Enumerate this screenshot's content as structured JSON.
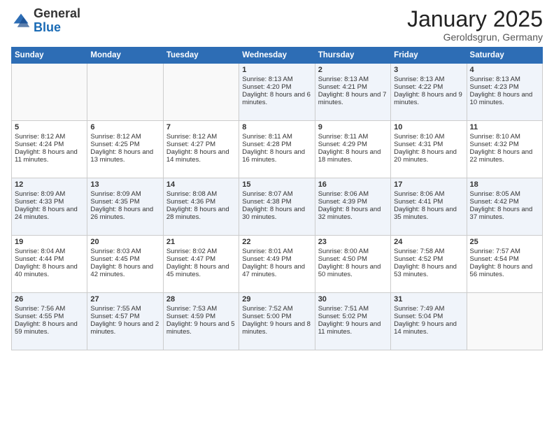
{
  "logo": {
    "general": "General",
    "blue": "Blue"
  },
  "title": "January 2025",
  "subtitle": "Geroldsgrun, Germany",
  "days_of_week": [
    "Sunday",
    "Monday",
    "Tuesday",
    "Wednesday",
    "Thursday",
    "Friday",
    "Saturday"
  ],
  "weeks": [
    [
      {
        "day": "",
        "content": ""
      },
      {
        "day": "",
        "content": ""
      },
      {
        "day": "",
        "content": ""
      },
      {
        "day": "1",
        "content": "Sunrise: 8:13 AM\nSunset: 4:20 PM\nDaylight: 8 hours and 6 minutes."
      },
      {
        "day": "2",
        "content": "Sunrise: 8:13 AM\nSunset: 4:21 PM\nDaylight: 8 hours and 7 minutes."
      },
      {
        "day": "3",
        "content": "Sunrise: 8:13 AM\nSunset: 4:22 PM\nDaylight: 8 hours and 9 minutes."
      },
      {
        "day": "4",
        "content": "Sunrise: 8:13 AM\nSunset: 4:23 PM\nDaylight: 8 hours and 10 minutes."
      }
    ],
    [
      {
        "day": "5",
        "content": "Sunrise: 8:12 AM\nSunset: 4:24 PM\nDaylight: 8 hours and 11 minutes."
      },
      {
        "day": "6",
        "content": "Sunrise: 8:12 AM\nSunset: 4:25 PM\nDaylight: 8 hours and 13 minutes."
      },
      {
        "day": "7",
        "content": "Sunrise: 8:12 AM\nSunset: 4:27 PM\nDaylight: 8 hours and 14 minutes."
      },
      {
        "day": "8",
        "content": "Sunrise: 8:11 AM\nSunset: 4:28 PM\nDaylight: 8 hours and 16 minutes."
      },
      {
        "day": "9",
        "content": "Sunrise: 8:11 AM\nSunset: 4:29 PM\nDaylight: 8 hours and 18 minutes."
      },
      {
        "day": "10",
        "content": "Sunrise: 8:10 AM\nSunset: 4:31 PM\nDaylight: 8 hours and 20 minutes."
      },
      {
        "day": "11",
        "content": "Sunrise: 8:10 AM\nSunset: 4:32 PM\nDaylight: 8 hours and 22 minutes."
      }
    ],
    [
      {
        "day": "12",
        "content": "Sunrise: 8:09 AM\nSunset: 4:33 PM\nDaylight: 8 hours and 24 minutes."
      },
      {
        "day": "13",
        "content": "Sunrise: 8:09 AM\nSunset: 4:35 PM\nDaylight: 8 hours and 26 minutes."
      },
      {
        "day": "14",
        "content": "Sunrise: 8:08 AM\nSunset: 4:36 PM\nDaylight: 8 hours and 28 minutes."
      },
      {
        "day": "15",
        "content": "Sunrise: 8:07 AM\nSunset: 4:38 PM\nDaylight: 8 hours and 30 minutes."
      },
      {
        "day": "16",
        "content": "Sunrise: 8:06 AM\nSunset: 4:39 PM\nDaylight: 8 hours and 32 minutes."
      },
      {
        "day": "17",
        "content": "Sunrise: 8:06 AM\nSunset: 4:41 PM\nDaylight: 8 hours and 35 minutes."
      },
      {
        "day": "18",
        "content": "Sunrise: 8:05 AM\nSunset: 4:42 PM\nDaylight: 8 hours and 37 minutes."
      }
    ],
    [
      {
        "day": "19",
        "content": "Sunrise: 8:04 AM\nSunset: 4:44 PM\nDaylight: 8 hours and 40 minutes."
      },
      {
        "day": "20",
        "content": "Sunrise: 8:03 AM\nSunset: 4:45 PM\nDaylight: 8 hours and 42 minutes."
      },
      {
        "day": "21",
        "content": "Sunrise: 8:02 AM\nSunset: 4:47 PM\nDaylight: 8 hours and 45 minutes."
      },
      {
        "day": "22",
        "content": "Sunrise: 8:01 AM\nSunset: 4:49 PM\nDaylight: 8 hours and 47 minutes."
      },
      {
        "day": "23",
        "content": "Sunrise: 8:00 AM\nSunset: 4:50 PM\nDaylight: 8 hours and 50 minutes."
      },
      {
        "day": "24",
        "content": "Sunrise: 7:58 AM\nSunset: 4:52 PM\nDaylight: 8 hours and 53 minutes."
      },
      {
        "day": "25",
        "content": "Sunrise: 7:57 AM\nSunset: 4:54 PM\nDaylight: 8 hours and 56 minutes."
      }
    ],
    [
      {
        "day": "26",
        "content": "Sunrise: 7:56 AM\nSunset: 4:55 PM\nDaylight: 8 hours and 59 minutes."
      },
      {
        "day": "27",
        "content": "Sunrise: 7:55 AM\nSunset: 4:57 PM\nDaylight: 9 hours and 2 minutes."
      },
      {
        "day": "28",
        "content": "Sunrise: 7:53 AM\nSunset: 4:59 PM\nDaylight: 9 hours and 5 minutes."
      },
      {
        "day": "29",
        "content": "Sunrise: 7:52 AM\nSunset: 5:00 PM\nDaylight: 9 hours and 8 minutes."
      },
      {
        "day": "30",
        "content": "Sunrise: 7:51 AM\nSunset: 5:02 PM\nDaylight: 9 hours and 11 minutes."
      },
      {
        "day": "31",
        "content": "Sunrise: 7:49 AM\nSunset: 5:04 PM\nDaylight: 9 hours and 14 minutes."
      },
      {
        "day": "",
        "content": ""
      }
    ]
  ]
}
